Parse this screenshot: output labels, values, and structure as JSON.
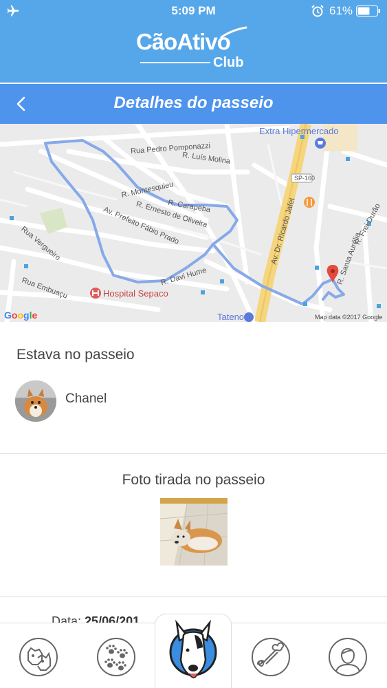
{
  "status_bar": {
    "time": "5:09 PM",
    "battery": "61%",
    "icons": [
      "airplane-icon",
      "alarm-icon",
      "battery-icon"
    ]
  },
  "brand": {
    "name": "CãoAtivo",
    "sub": "Club"
  },
  "header": {
    "title": "Detalhes do passeio",
    "back_icon": "chevron-left-icon"
  },
  "map": {
    "streets": [
      "Rua Pedro Pomponazzi",
      "R. Luís Molina",
      "R. Montesquieu",
      "R. Carapeba",
      "R. Ernesto de Oliveira",
      "Av. Prefeito Fábio Prado",
      "R. Davi Hume",
      "Rua Vergueiro",
      "Rua Embuaçu",
      "Av. Dr. Ricardo Jafet",
      "R. Santa Aurélia",
      "R. Frei Durão",
      "SP-160"
    ],
    "pois": {
      "supermarket": "Extra Hipermercado",
      "hospital": "Hospital Sepaco",
      "store": "Tateno"
    },
    "google": "Google",
    "credit": "Map data ©2017 Google"
  },
  "walk_companions": {
    "heading": "Estava no passeio",
    "pets": [
      {
        "name": "Chanel"
      }
    ]
  },
  "walk_photo": {
    "heading": "Foto tirada no passeio"
  },
  "details": {
    "date_label": "Data:",
    "date_value": "25/06/201"
  },
  "tabs": [
    {
      "icon": "dogs-icon"
    },
    {
      "icon": "paw-prints-icon"
    },
    {
      "icon": "bull-terrier-icon"
    },
    {
      "icon": "bone-icon"
    },
    {
      "icon": "user-profile-icon"
    }
  ],
  "colors": {
    "header_blue": "#56a7ea",
    "title_bar_blue": "#4e93ec",
    "route_blue": "#7aa7ee",
    "text_gray": "#444444"
  }
}
